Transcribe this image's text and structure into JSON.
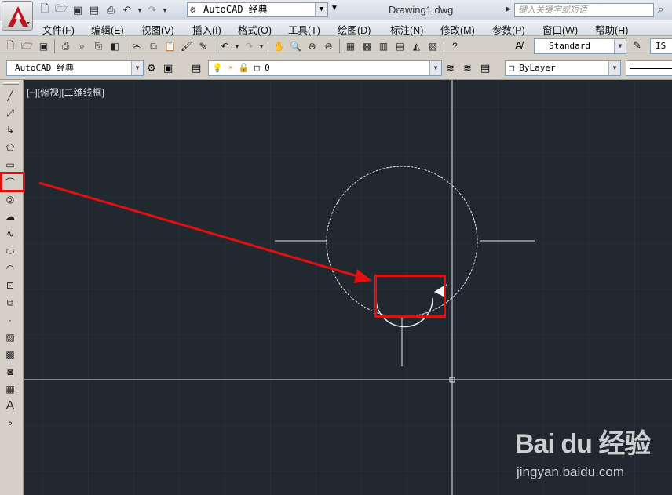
{
  "title": {
    "workspace": "AutoCAD 经典",
    "document": "Drawing1.dwg",
    "search_placeholder": "键入关键字或短语"
  },
  "menu": [
    "文件(F)",
    "编辑(E)",
    "视图(V)",
    "插入(I)",
    "格式(O)",
    "工具(T)",
    "绘图(D)",
    "标注(N)",
    "修改(M)",
    "参数(P)",
    "窗口(W)",
    "帮助(H)"
  ],
  "toolbar1": {
    "text_style": "Standard",
    "dim_style_partial": "IS"
  },
  "toolbar2": {
    "workspace": "AutoCAD 经典",
    "layer": "0",
    "color": "ByLayer"
  },
  "canvas": {
    "viewport_label": "[−][俯视][二维线框]",
    "background": "#212830"
  },
  "annotations": {
    "highlight_color": "#e01010"
  },
  "watermark": {
    "logo": "Bai du 经验",
    "url": "jingyan.baidu.com"
  }
}
